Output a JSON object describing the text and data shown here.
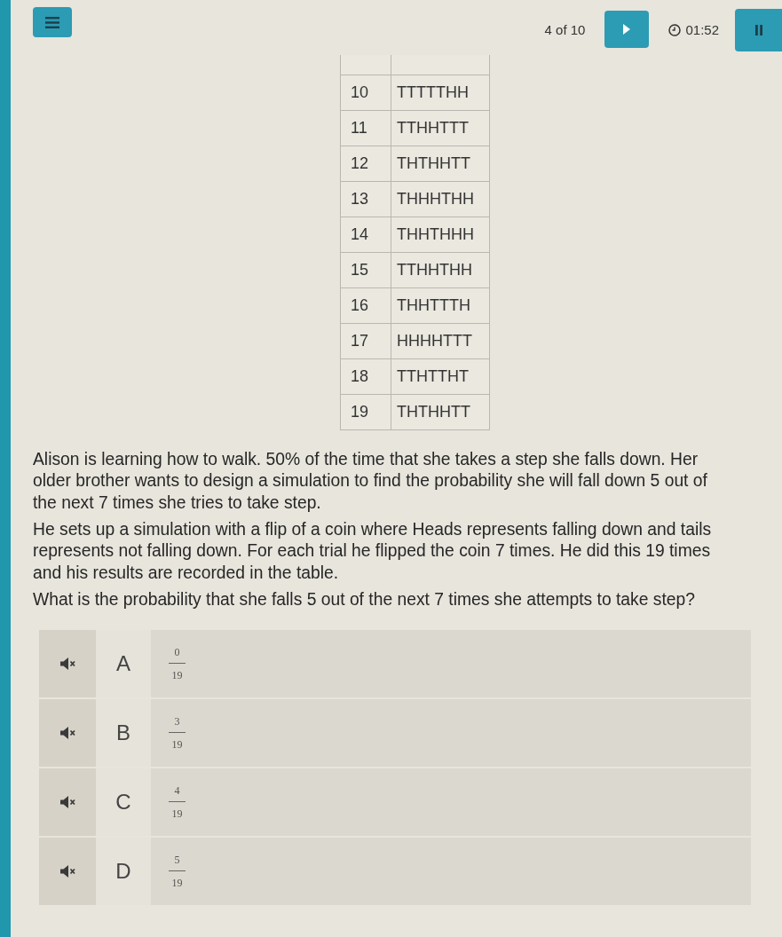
{
  "header": {
    "progress": "4 of 10",
    "timer": "01:52"
  },
  "table": {
    "rows": [
      [
        "10",
        "TTTTTHH"
      ],
      [
        "11",
        "TTHHTTT"
      ],
      [
        "12",
        "THTHHTT"
      ],
      [
        "13",
        "THHHTHH"
      ],
      [
        "14",
        "THHTHHH"
      ],
      [
        "15",
        "TTHHTHH"
      ],
      [
        "16",
        "THHTTTH"
      ],
      [
        "17",
        "HHHHTTT"
      ],
      [
        "18",
        "TTHTTHT"
      ],
      [
        "19",
        "THTHHTT"
      ]
    ]
  },
  "question": {
    "paragraphs": [
      "Alison is learning how to walk. 50% of the time that she takes a step she falls down. Her older brother wants to design a simulation to find the probability she will fall down 5 out of the next 7 times she tries to take step.",
      "He sets up a simulation with a flip of a coin where Heads represents falling down and tails represents not falling down. For each trial he flipped the coin 7 times. He did this 19 times and his results are recorded in the table.",
      "What is the probability that she falls 5 out of the next 7 times she attempts to take step?"
    ]
  },
  "options": [
    {
      "letter": "A",
      "numerator": "0",
      "denominator": "19",
      "selected": false
    },
    {
      "letter": "B",
      "numerator": "3",
      "denominator": "19",
      "selected": false
    },
    {
      "letter": "C",
      "numerator": "4",
      "denominator": "19",
      "selected": false
    },
    {
      "letter": "D",
      "numerator": "5",
      "denominator": "19",
      "selected": false
    }
  ]
}
